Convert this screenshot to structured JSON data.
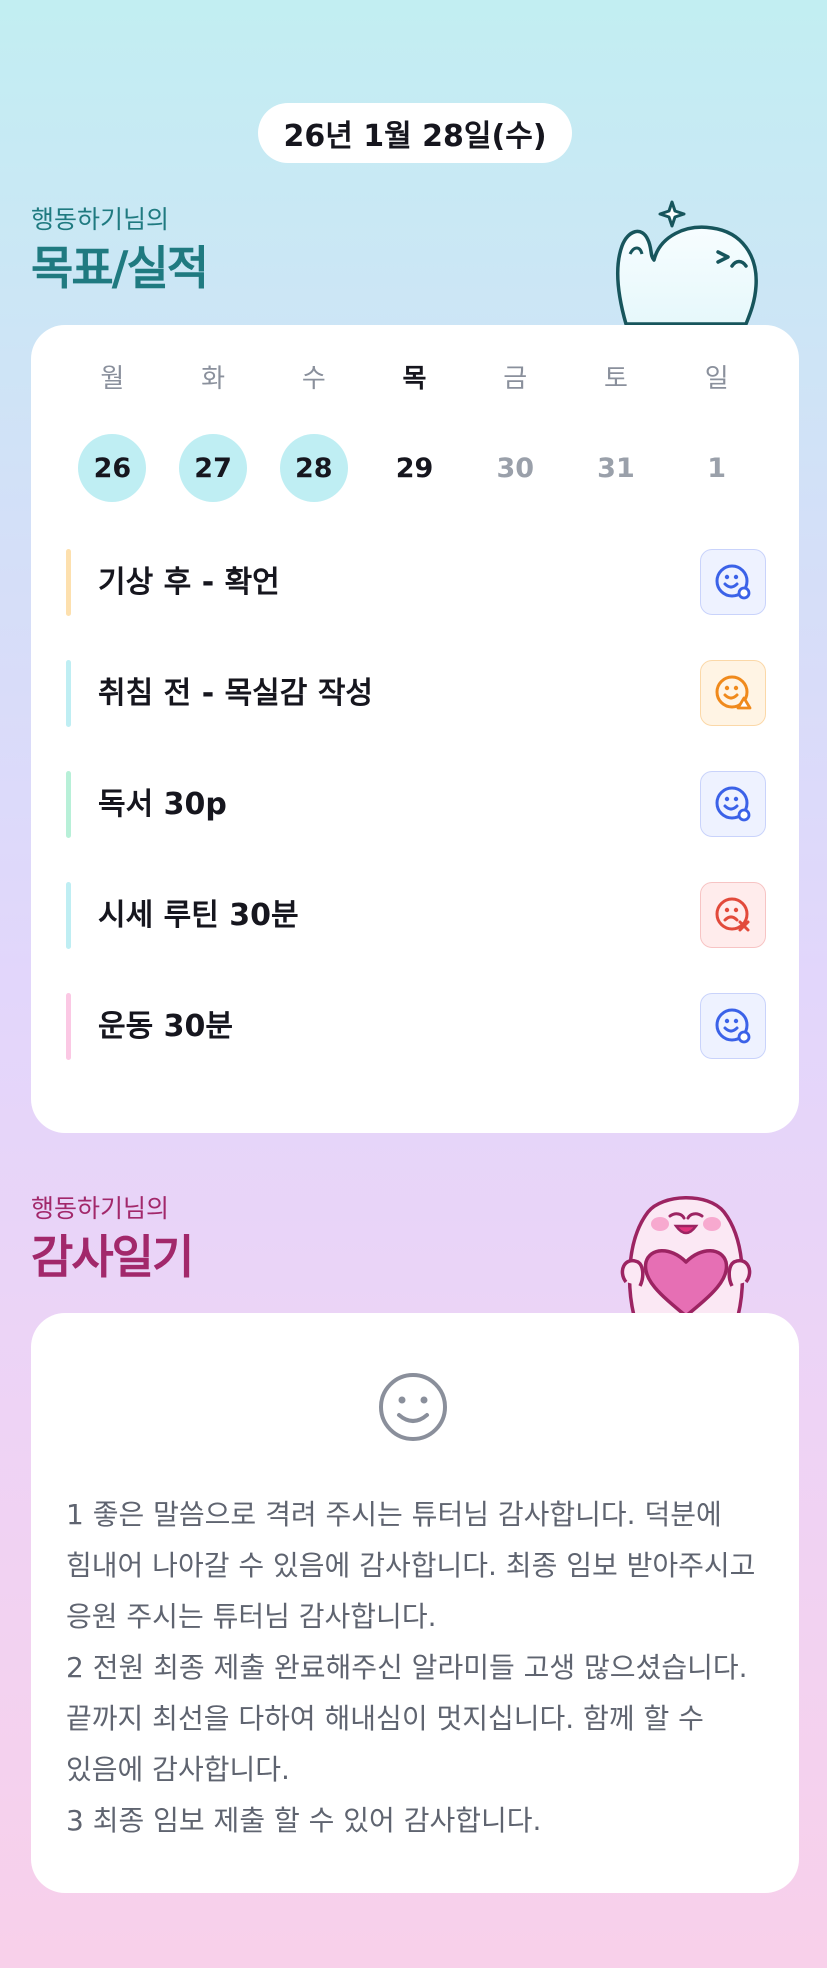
{
  "date_label": "26년 1월 28일(수)",
  "goal_section": {
    "subtitle": "행동하기님의",
    "title": "목표/실적",
    "mascot_icon": "white-blob-thumbs-up-mascot",
    "weekdays": [
      {
        "label": "월",
        "date": "26",
        "status": "done"
      },
      {
        "label": "화",
        "date": "27",
        "status": "done"
      },
      {
        "label": "수",
        "date": "28",
        "status": "done"
      },
      {
        "label": "목",
        "date": "29",
        "status": "today"
      },
      {
        "label": "금",
        "date": "30",
        "status": "future"
      },
      {
        "label": "토",
        "date": "31",
        "status": "future"
      },
      {
        "label": "일",
        "date": "1",
        "status": "future"
      }
    ],
    "goals": [
      {
        "label": "기상 후 - 확언",
        "bar_color": "#fde0ae",
        "status": "done",
        "status_icon": "smile-circle-icon",
        "status_color": "#3b62e8"
      },
      {
        "label": "취침 전 - 목실감 작성",
        "bar_color": "#bfeef3",
        "status": "partial",
        "status_icon": "smile-triangle-icon",
        "status_color": "#f08a1c"
      },
      {
        "label": "독서 30p",
        "bar_color": "#b8f0d8",
        "status": "done",
        "status_icon": "smile-circle-icon",
        "status_color": "#3b62e8"
      },
      {
        "label": "시세 루틴 30분",
        "bar_color": "#bfeef3",
        "status": "failed",
        "status_icon": "frown-x-icon",
        "status_color": "#e24a3b"
      },
      {
        "label": "운동 30분",
        "bar_color": "#fbc8e4",
        "status": "done",
        "status_icon": "smile-circle-icon",
        "status_color": "#3b62e8"
      }
    ]
  },
  "gratitude_section": {
    "subtitle": "행동하기님의",
    "title": "감사일기",
    "mascot_icon": "pink-blob-heart-mascot",
    "mood_icon": "smile-face-icon",
    "text": "1 좋은 말씀으로 격려 주시는 튜터님 감사합니다. 덕분에 힘내어 나아갈 수 있음에 감사합니다. 최종 임보 받아주시고 응원 주시는 튜터님 감사합니다.\n2 전원 최종 제출 완료해주신 알라미들 고생 많으셨습니다. 끝까지 최선을 다하여 해내심이 멋지십니다. 함께 할 수 있음에 감사합니다.\n3 최종 임보 제출 할 수 있어 감사합니다."
  },
  "colors": {
    "accent_teal": "#1f7a80",
    "accent_plum": "#a2286b",
    "day_done_bg": "#bfeef3"
  }
}
